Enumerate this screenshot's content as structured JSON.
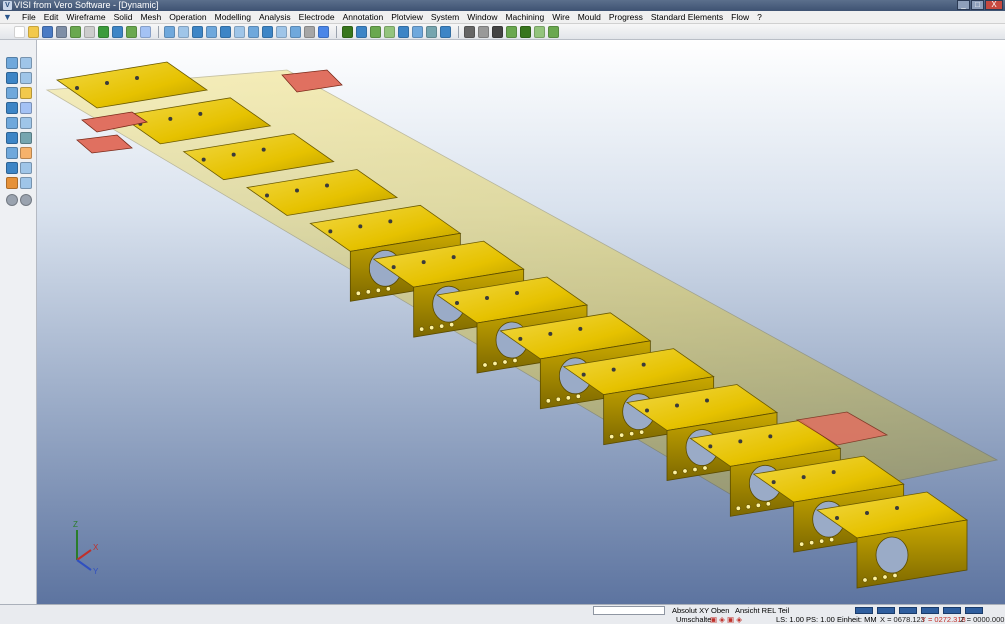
{
  "window": {
    "title": "VISI from Vero Software - [Dynamic]",
    "buttons": [
      "_",
      "□",
      "X"
    ]
  },
  "menu": {
    "items": [
      "File",
      "Edit",
      "Wireframe",
      "Solid",
      "Mesh",
      "Operation",
      "Modelling",
      "Analysis",
      "Electrode",
      "Annotation",
      "Plotview",
      "System",
      "Window",
      "Machining",
      "Wire",
      "Mould",
      "Progress",
      "Standard Elements",
      "Flow",
      "?"
    ]
  },
  "viewport": {
    "background_top": "#ffffff",
    "background_bottom": "#5d74a0",
    "part_color": "#e6c200",
    "part_shadow": "#a88f00",
    "highlight_color": "#e07060",
    "triad_labels": {
      "x": "X",
      "y": "Y",
      "z": "Z"
    }
  },
  "status": {
    "search_value": "",
    "view_mode": "Absolut XY Oben",
    "view_label": "Ansicht REL",
    "teil_label": "Teil",
    "umschalte": "Umschalte",
    "ls_ps": "LS: 1.00 PS: 1.00",
    "einheit": "Einheit: MM",
    "x_coord": "X = 0678.123",
    "y_coord": "Y = 0272.318",
    "z_coord": "Z = 0000.000"
  }
}
